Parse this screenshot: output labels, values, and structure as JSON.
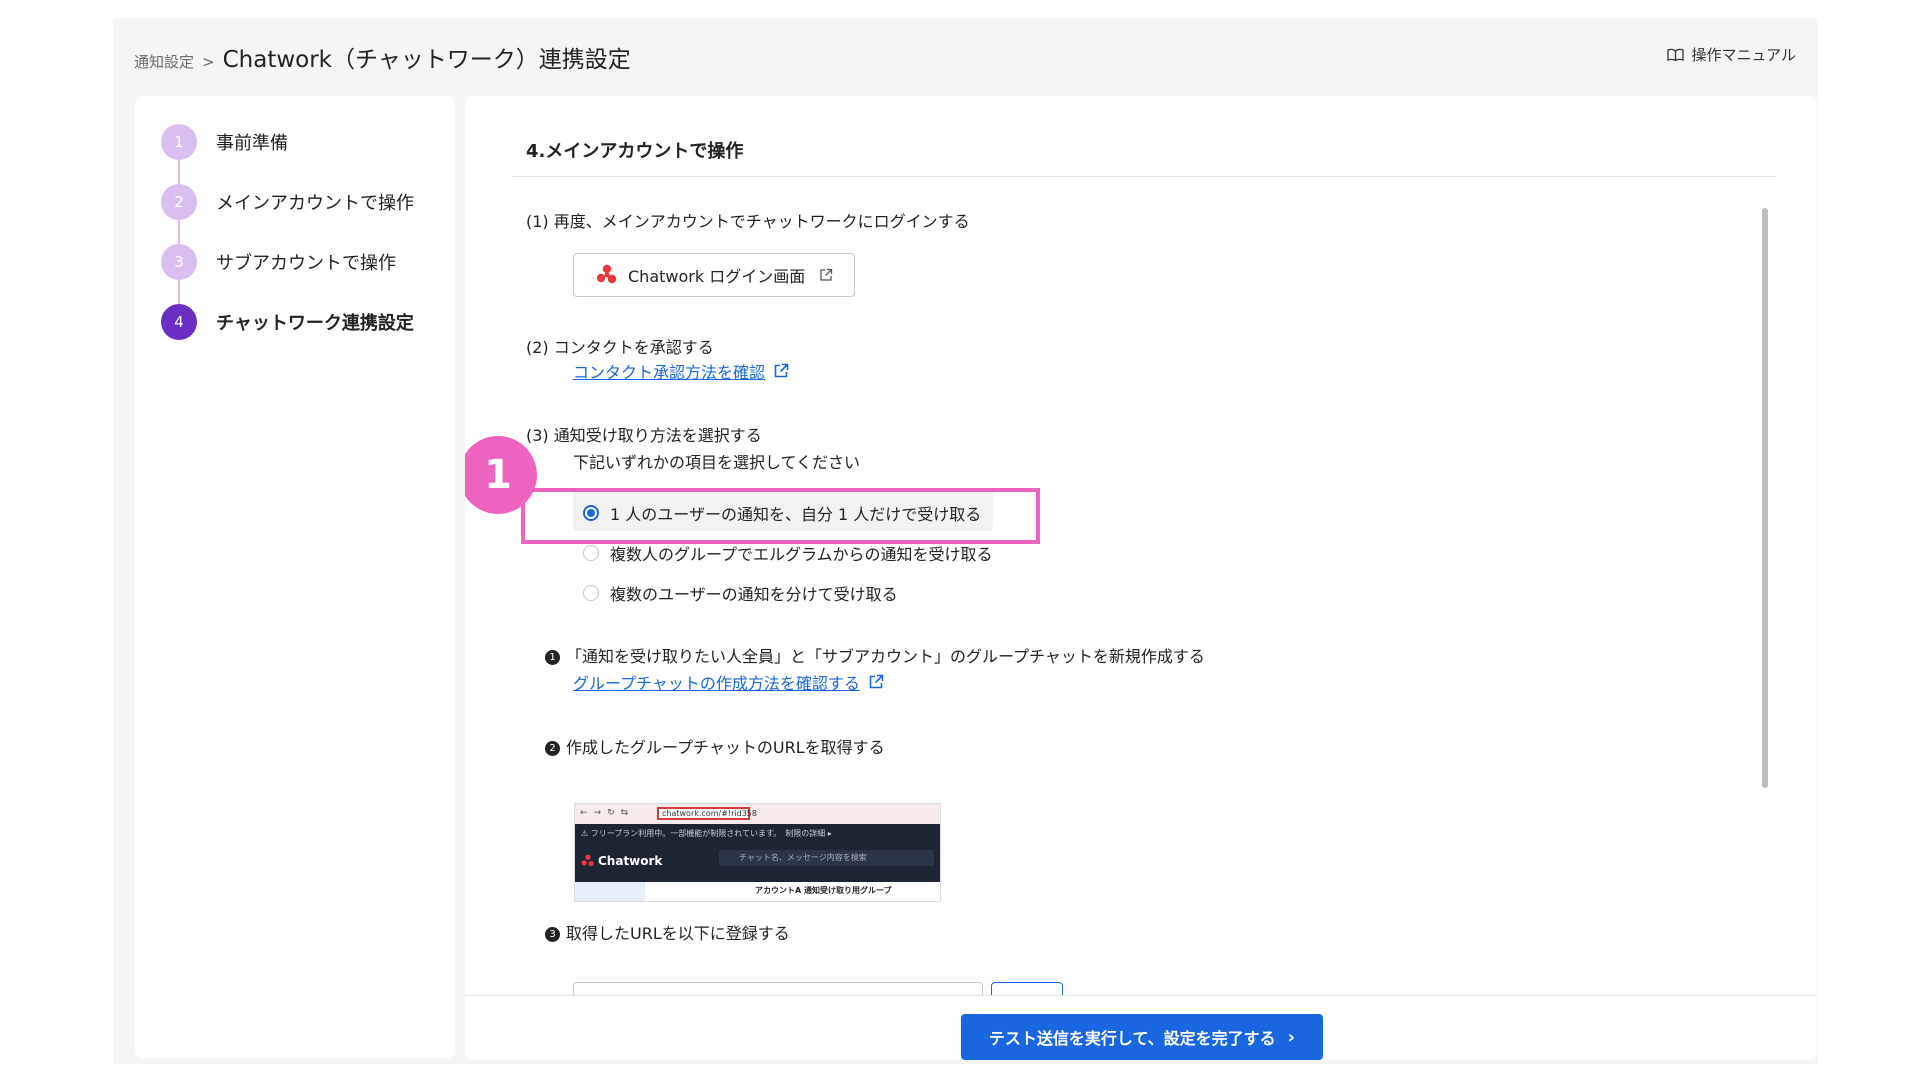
{
  "breadcrumb": {
    "parent": "通知設定",
    "separator": ">",
    "title": "Chatwork（チャットワーク）連携設定"
  },
  "header": {
    "manual_label": "操作マニュアル"
  },
  "steps": [
    {
      "num": "1",
      "label": "事前準備"
    },
    {
      "num": "2",
      "label": "メインアカウントで操作"
    },
    {
      "num": "3",
      "label": "サブアカウントで操作"
    },
    {
      "num": "4",
      "label": "チャットワーク連携設定"
    }
  ],
  "main": {
    "section_title": "4.メインアカウントで操作",
    "step1": {
      "text": "(1) 再度、メインアカウントでチャットワークにログインする",
      "button_label": "Chatwork ログイン画面"
    },
    "step2": {
      "text": "(2) コンタクトを承認する",
      "link_label": "コンタクト承認方法を確認"
    },
    "step3": {
      "text": "(3) 通知受け取り方法を選択する",
      "instruction": "下記いずれかの項目を選択してください",
      "options": [
        "1 人のユーザーの通知を、自分 1 人だけで受け取る",
        "複数人のグループでエルグラムからの通知を受け取る",
        "複数のユーザーの通知を分けて受け取る"
      ],
      "selected_index": 0
    },
    "annotation_marker": "1",
    "substeps": {
      "a_bullet": "1",
      "a_text": "「通知を受け取りたい人全員」と「サブアカウント」のグループチャットを新規作成する",
      "a_link": "グループチャットの作成方法を確認する",
      "b_bullet": "2",
      "b_text": "作成したグループチャットのURLを取得する",
      "c_bullet": "3",
      "c_text": "取得したURLを以下に登録する"
    },
    "thumbnail": {
      "url": "chatwork.com/#!rid358",
      "notice": "⚠ フリープラン利用中。一部機能が制限されています。　制限の詳細 ▸",
      "brand": "Chatwork",
      "search_placeholder": "チャット名、メッセージ内容を検索",
      "room_name": "アカウントA 通知受け取り用グループ"
    },
    "footer_button": "テスト送信を実行して、設定を完了する"
  },
  "colors": {
    "accent": "#1a66e0",
    "step_active": "#6a2fc2",
    "step_inactive": "#d9bff0",
    "highlight": "#ee62c0"
  }
}
